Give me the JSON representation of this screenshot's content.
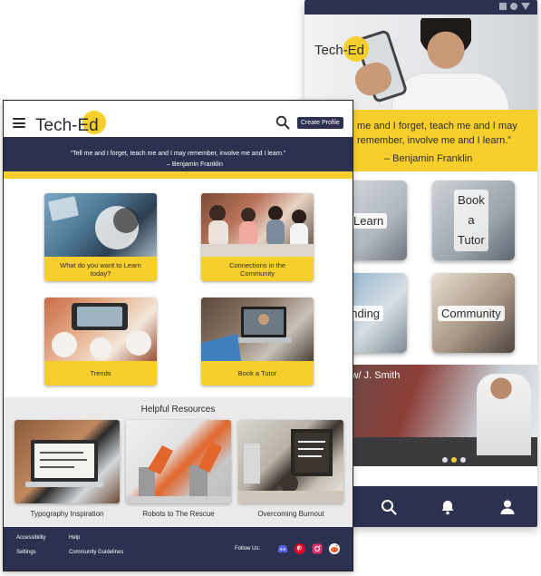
{
  "brand": {
    "name": "Tech-Ed"
  },
  "colors": {
    "navy": "#2d3150",
    "yellow": "#f7cf2d",
    "instagram": "#e1306c",
    "pinterest": "#e60023",
    "discord": "#5865f2",
    "reddit": "#ff4500"
  },
  "phone": {
    "status_icons": [
      "square-icon",
      "circle-icon",
      "triangle-icon"
    ],
    "quote": "Tell me and I forget, teach me and I may remember, involve me and I learn.”",
    "quote_visible": "me and I forget, teach me and I may\nremember, involve me and I learn.”",
    "author": "– Benjamin Franklin",
    "cards": {
      "learn": "Learn",
      "tutor": "Book\na\nTutor",
      "trending": "ending",
      "community": "Community"
    },
    "feature_title": "le w/ J. Smith",
    "carousel": {
      "count": 3,
      "active": 1
    },
    "nav": [
      "home-icon",
      "search-icon",
      "bell-icon",
      "user-icon"
    ]
  },
  "desktop": {
    "header": {
      "create_profile": "Create Profile"
    },
    "quote": {
      "text": "“Tell me and I forget, teach me and I may remember, involve me and I learn.”",
      "author": "– Benjamin Franklin"
    },
    "tiles": [
      {
        "label": "What do you want to Learn today?"
      },
      {
        "label": "Connections in the Community"
      },
      {
        "label": "Trends"
      },
      {
        "label": "Book a Tutor"
      }
    ],
    "resources": {
      "title": "Helpful Resources",
      "items": [
        {
          "label": "Typography Inspiration"
        },
        {
          "label": "Robots to The Rescue"
        },
        {
          "label": "Overcoming Burnout"
        }
      ]
    },
    "footer": {
      "links": [
        "Accessibility",
        "Help",
        "Settings",
        "Community Guidelines"
      ],
      "follow_us": "Follow Us:",
      "social": [
        "discord-icon",
        "pinterest-icon",
        "instagram-icon",
        "reddit-icon"
      ]
    }
  }
}
